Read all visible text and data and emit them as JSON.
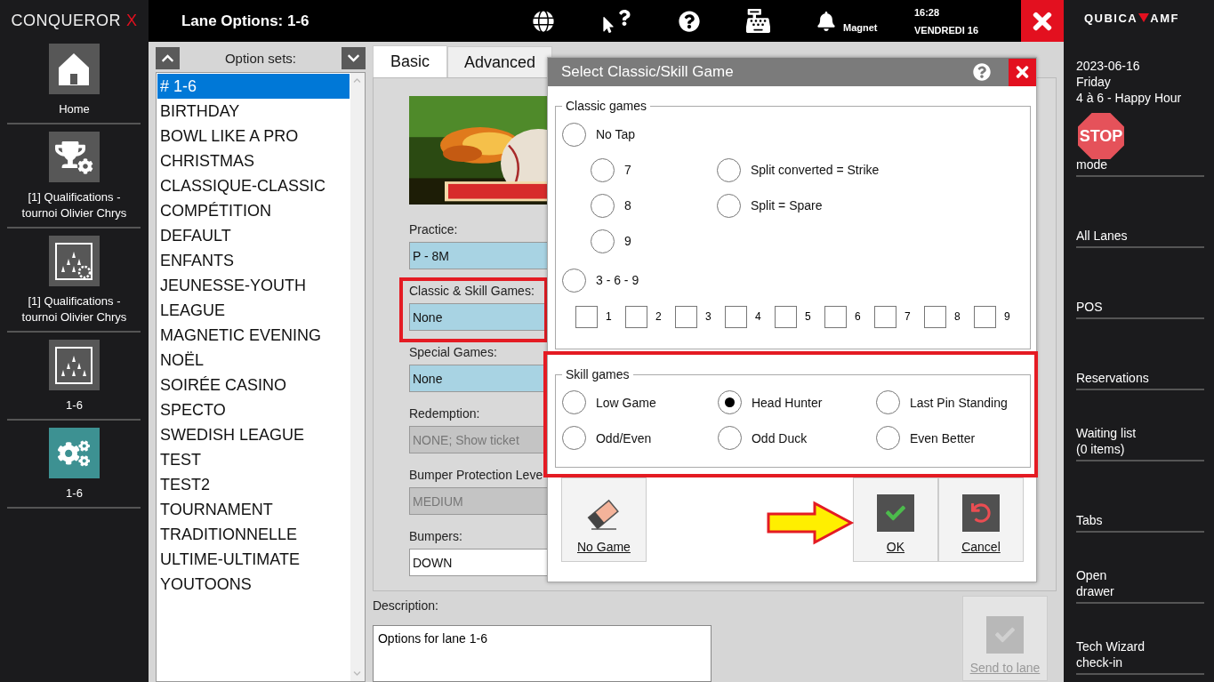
{
  "app_logo": {
    "name": "CONQUEROR",
    "mark": "X"
  },
  "left_nav": [
    {
      "label": "Home",
      "kind": "home",
      "selected": false
    },
    {
      "label": "[1] Qualifications - tournoi Olivier Chrys",
      "kind": "trophy",
      "selected": false
    },
    {
      "label": "[1] Qualifications - tournoi Olivier Chrys",
      "kind": "pinsgear",
      "selected": false
    },
    {
      "label": "1-6",
      "kind": "pins",
      "selected": false
    },
    {
      "label": "1-6",
      "kind": "gears",
      "selected": true
    }
  ],
  "top_bar": {
    "title": "Lane Options: 1-6",
    "user": "Magnet",
    "time": "16:28",
    "date": "VENDREDI 16"
  },
  "option_sets": {
    "title": "Option sets:",
    "items": [
      {
        "label": "# 1-6",
        "selected": true
      },
      {
        "label": "BIRTHDAY",
        "selected": false
      },
      {
        "label": "BOWL LIKE A PRO",
        "selected": false
      },
      {
        "label": "CHRISTMAS",
        "selected": false
      },
      {
        "label": "CLASSIQUE-CLASSIC",
        "selected": false
      },
      {
        "label": "COMPÉTITION",
        "selected": false
      },
      {
        "label": "DEFAULT",
        "selected": false
      },
      {
        "label": "ENFANTS",
        "selected": false
      },
      {
        "label": "JEUNESSE-YOUTH",
        "selected": false
      },
      {
        "label": "LEAGUE",
        "selected": false
      },
      {
        "label": "MAGNETIC EVENING",
        "selected": false
      },
      {
        "label": "NOËL",
        "selected": false
      },
      {
        "label": "SOIRÉE CASINO",
        "selected": false
      },
      {
        "label": "SPECTO",
        "selected": false
      },
      {
        "label": "SWEDISH LEAGUE",
        "selected": false
      },
      {
        "label": "TEST",
        "selected": false
      },
      {
        "label": "TEST2",
        "selected": false
      },
      {
        "label": "TOURNAMENT",
        "selected": false
      },
      {
        "label": "TRADITIONNELLE",
        "selected": false
      },
      {
        "label": "ULTIME-ULTIMATE",
        "selected": false
      },
      {
        "label": "YOUTOONS",
        "selected": false
      }
    ]
  },
  "tabs": [
    {
      "label": "Basic",
      "selected": true
    },
    {
      "label": "Advanced",
      "selected": false
    }
  ],
  "basic": {
    "fields": [
      {
        "label": "Practice:",
        "value": "P - 8M",
        "kind": "blue"
      },
      {
        "label": "Classic & Skill Games:",
        "value": "None",
        "kind": "blue"
      },
      {
        "label": "Special Games:",
        "value": "None",
        "kind": "blue"
      },
      {
        "label": "Redemption:",
        "value": "NONE; Show ticket",
        "kind": "disabled"
      },
      {
        "label": "Bumper Protection Leve",
        "value": "MEDIUM",
        "kind": "disabled"
      },
      {
        "label": "Bumpers:",
        "value": "DOWN",
        "kind": "white"
      }
    ]
  },
  "description": {
    "label": "Description:",
    "value": "Options for lane 1-6"
  },
  "send_button": {
    "label": "Send to lane",
    "disabled": true
  },
  "dialog": {
    "title": "Select Classic/Skill Game",
    "classic_games": {
      "title": "Classic games",
      "no_tap": {
        "label": "No Tap",
        "selected": false
      },
      "no_tap_options": [
        {
          "label": "7",
          "selected": false
        },
        {
          "label": "8",
          "selected": false
        },
        {
          "label": "9",
          "selected": false
        }
      ],
      "split_options": [
        {
          "label": "Split converted = Strike",
          "selected": false
        },
        {
          "label": "Split = Spare",
          "selected": false
        }
      ],
      "three_six_nine": {
        "label": "3 - 6 - 9",
        "selected": false
      },
      "pins": [
        {
          "label": "1",
          "checked": false
        },
        {
          "label": "2",
          "checked": false
        },
        {
          "label": "3",
          "checked": false
        },
        {
          "label": "4",
          "checked": false
        },
        {
          "label": "5",
          "checked": false
        },
        {
          "label": "6",
          "checked": false
        },
        {
          "label": "7",
          "checked": false
        },
        {
          "label": "8",
          "checked": false
        },
        {
          "label": "9",
          "checked": false
        }
      ]
    },
    "skill_games": {
      "title": "Skill games",
      "options": [
        {
          "label": "Low Game",
          "selected": false
        },
        {
          "label": "Head Hunter",
          "selected": true
        },
        {
          "label": "Last Pin Standing",
          "selected": false
        },
        {
          "label": "Odd/Even",
          "selected": false
        },
        {
          "label": "Odd Duck",
          "selected": false
        },
        {
          "label": "Even Better",
          "selected": false
        }
      ]
    },
    "buttons": [
      {
        "label": "No Game",
        "kind": "eraser"
      },
      {
        "label": "OK",
        "kind": "ok"
      },
      {
        "label": "Cancel",
        "kind": "cancel"
      }
    ]
  },
  "right_panel": {
    "logo": {
      "left": "QUBICA",
      "right": "AMF"
    },
    "date_lines": [
      "2023-06-16",
      "Friday",
      "4 à 6 - Happy Hour"
    ],
    "stop_sign": "STOP",
    "items": [
      {
        "label": "mode"
      },
      {
        "label": "All Lanes"
      },
      {
        "label": "POS"
      },
      {
        "label": "Reservations"
      },
      {
        "label": "Waiting list\n(0 items)"
      },
      {
        "label": "Tabs"
      },
      {
        "label": "Open\ndrawer"
      },
      {
        "label": "Tech Wizard\ncheck-in"
      }
    ]
  }
}
